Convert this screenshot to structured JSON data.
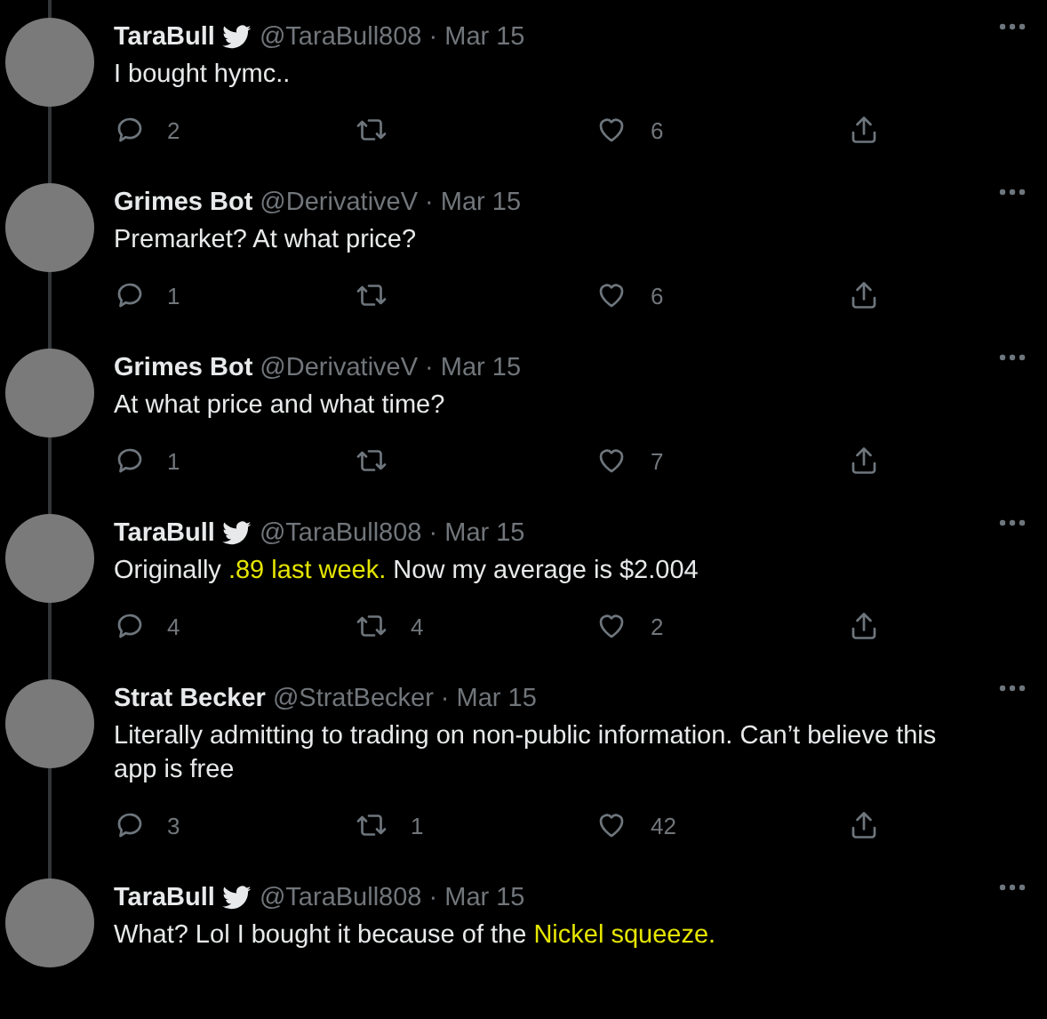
{
  "tweets": [
    {
      "name": "TaraBull",
      "verified": true,
      "handle": "@TaraBull808",
      "separator": "·",
      "date": "Mar 15",
      "body": [
        {
          "text": "I bought hymc..",
          "highlighted": false
        }
      ],
      "replies": "2",
      "likes": "6"
    },
    {
      "name": "Grimes Bot",
      "verified": false,
      "handle": "@DerivativeV",
      "separator": "·",
      "date": "Mar 15",
      "body": [
        {
          "text": "Premarket? At what price?",
          "highlighted": false
        }
      ],
      "replies": "1",
      "likes": "6"
    },
    {
      "name": "Grimes Bot",
      "verified": false,
      "handle": "@DerivativeV",
      "separator": "·",
      "date": "Mar 15",
      "body": [
        {
          "text": "At what price and what time?",
          "highlighted": false
        }
      ],
      "replies": "1",
      "likes": "7"
    },
    {
      "name": "TaraBull",
      "verified": true,
      "handle": "@TaraBull808",
      "separator": "·",
      "date": "Mar 15",
      "body": [
        {
          "text": "Originally ",
          "highlighted": false
        },
        {
          "text": ".89 last week.",
          "highlighted": true
        },
        {
          "text": " Now my average is $2.004",
          "highlighted": false
        }
      ],
      "replies": "4",
      "retweets": "4",
      "likes": "2"
    },
    {
      "name": "Strat Becker",
      "verified": false,
      "handle": "@StratBecker",
      "separator": "·",
      "date": "Mar 15",
      "body": [
        {
          "text": "Literally admitting to trading on non-public information. Can’t believe this app is free",
          "highlighted": false
        }
      ],
      "replies": "3",
      "retweets": "1",
      "likes": "42"
    },
    {
      "name": "TaraBull",
      "verified": true,
      "handle": "@TaraBull808",
      "separator": "·",
      "date": "Mar 15",
      "body": [
        {
          "text": "What? Lol I bought it because of the ",
          "highlighted": false
        },
        {
          "text": "Nickel squeeze.",
          "highlighted": true
        }
      ]
    }
  ]
}
